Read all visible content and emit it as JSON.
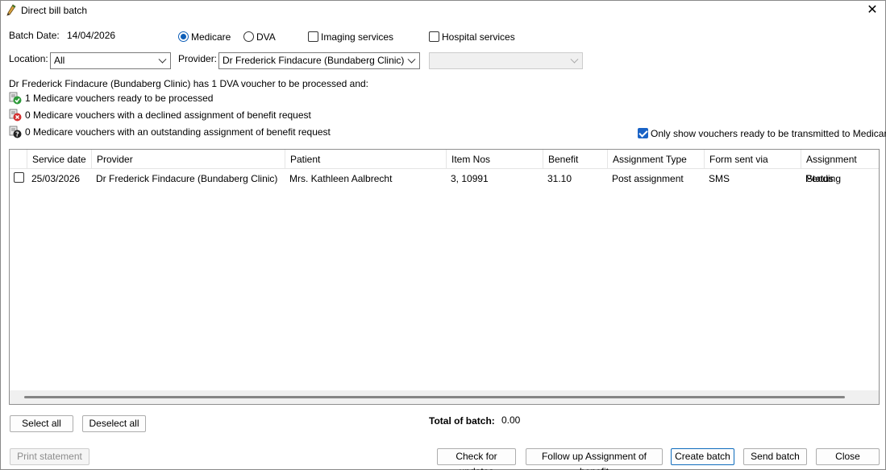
{
  "window": {
    "title": "Direct bill batch",
    "close_glyph": "✕"
  },
  "batch_date": {
    "label": "Batch Date:",
    "value": "14/04/2026"
  },
  "options": {
    "medicare": "Medicare",
    "dva": "DVA",
    "imaging": "Imaging services",
    "hospital": "Hospital services"
  },
  "location": {
    "label": "Location:",
    "value": "All"
  },
  "provider": {
    "label": "Provider:",
    "value": "Dr Frederick Findacure (Bundaberg Clinic)",
    "secondary_value": ""
  },
  "summary": {
    "headline": "Dr Frederick Findacure (Bundaberg Clinic) has 1 DVA voucher to be processed and:",
    "ready": "1 Medicare vouchers ready to be processed",
    "declined": "0 Medicare vouchers with a declined assignment of benefit request",
    "outstanding": "0 Medicare vouchers with an outstanding assignment of benefit request"
  },
  "only_ready_label": "Only show vouchers ready to be transmitted to Medicare",
  "table": {
    "columns": [
      "Service date",
      "Provider",
      "Patient",
      "Item Nos",
      "Benefit",
      "Assignment Type",
      "Form sent via",
      "Assignment Status"
    ],
    "rows": [
      [
        "25/03/2026",
        "Dr Frederick Findacure (Bundaberg Clinic)",
        "Mrs. Kathleen Aalbrecht",
        "3, 10991",
        "31.10",
        "Post assignment",
        "SMS",
        "Pending"
      ]
    ]
  },
  "buttons": {
    "select_all": "Select all",
    "deselect_all": "Deselect all",
    "print_statement": "Print statement",
    "check_updates": "Check for updates",
    "follow_up": "Follow up Assignment of benefit",
    "create_batch": "Create batch",
    "send_batch": "Send batch",
    "close": "Close"
  },
  "total": {
    "label": "Total of batch:",
    "value": "0.00"
  },
  "icons": {
    "app": "pen-icon",
    "ready": "voucher-check-icon",
    "declined": "voucher-declined-icon",
    "outstanding": "voucher-question-icon"
  },
  "colors": {
    "accent": "#0f5fb8",
    "ok": "#2e9b3a",
    "error": "#d32f2f"
  }
}
